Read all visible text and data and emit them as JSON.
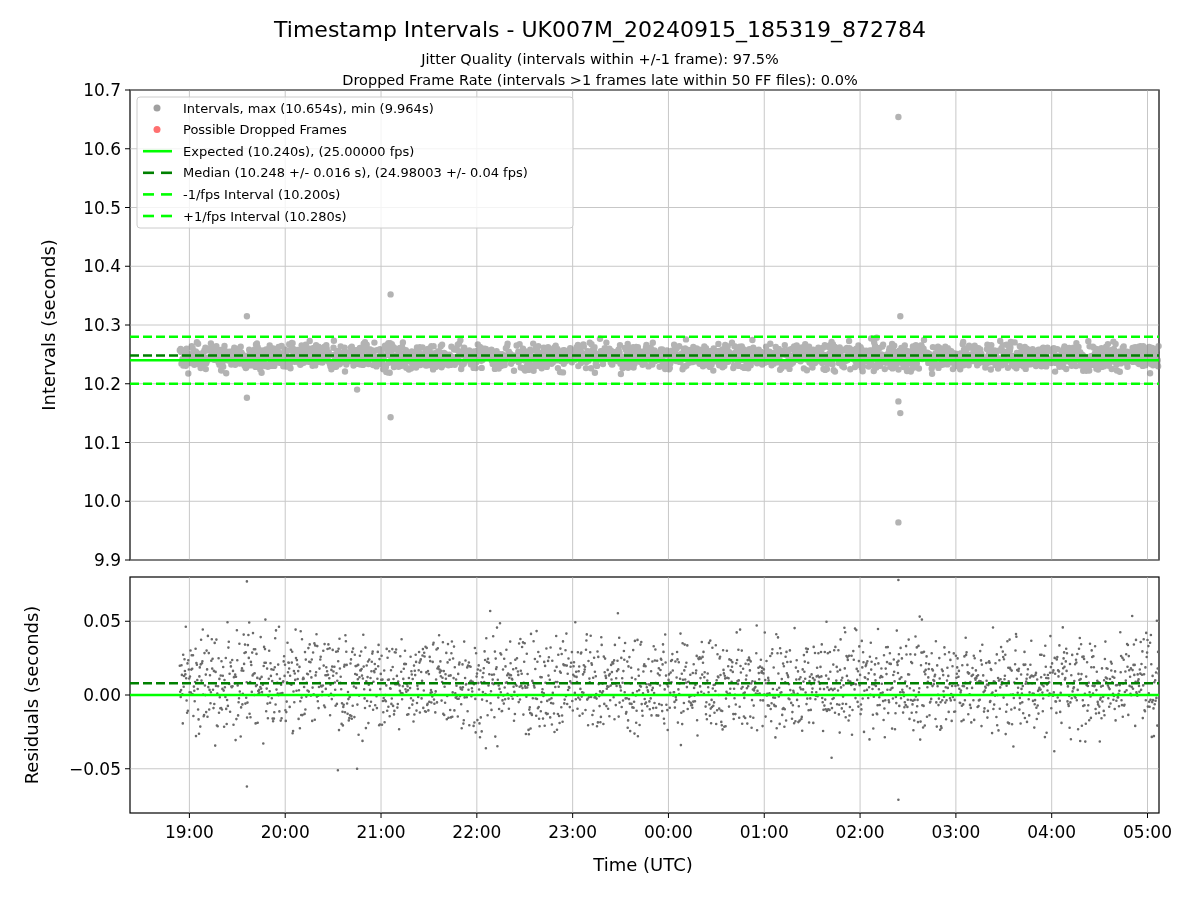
{
  "figure": {
    "title": "Timestamp Intervals - UK007M_20240915_185319_872784",
    "subtitles": [
      "Jitter Quality (intervals within +/-1 frame): 97.5%",
      "Dropped Frame Rate (intervals >1 frames late within 50 FF files): 0.0%"
    ]
  },
  "top_plot": {
    "legend": [
      {
        "label": "Intervals, max (10.654s), min (9.964s)",
        "color": "#a0a0a0",
        "kind": "marker"
      },
      {
        "label": "Possible Dropped Frames",
        "color": "#ff7070",
        "kind": "marker"
      },
      {
        "label": "Expected (10.240s), (25.00000 fps)",
        "color": "#00ff00",
        "kind": "solid"
      },
      {
        "label": "Median (10.248 +/- 0.016 s), (24.98003 +/- 0.04 fps)",
        "color": "#008000",
        "kind": "dashed"
      },
      {
        "label": "-1/fps Interval (10.200s)",
        "color": "#00ff00",
        "kind": "dashed"
      },
      {
        "label": "+1/fps Interval (10.280s)",
        "color": "#00ff00",
        "kind": "dashed"
      }
    ],
    "chart_data": {
      "type": "line",
      "ylabel": "Intervals (seconds)",
      "grid": true,
      "categories": [
        null,
        null,
        null,
        null,
        null,
        null,
        null,
        null,
        null,
        null,
        null
      ],
      "ylim": [
        9.9,
        10.7
      ],
      "yticks": [
        {
          "value": 9.9,
          "label": "9.9"
        },
        {
          "value": 10,
          "label": "10.0"
        },
        {
          "value": 10.1,
          "label": "10.1"
        },
        {
          "value": 10.2,
          "label": "10.2"
        },
        {
          "value": 10.3,
          "label": "10.3"
        },
        {
          "value": 10.4,
          "label": "10.4"
        },
        {
          "value": 10.5,
          "label": "10.5"
        },
        {
          "value": 10.6,
          "label": "10.6"
        },
        {
          "value": 10.7,
          "label": "10.7"
        }
      ],
      "ref_lines": [
        {
          "axis": "y",
          "value": 10.24,
          "color": "#00ff00"
        },
        {
          "axis": "y",
          "value": 10.248,
          "color": "#008000"
        },
        {
          "axis": "y",
          "value": 10.2,
          "color": "#00ff00"
        },
        {
          "axis": "y",
          "value": 10.28,
          "color": "#00ff00"
        }
      ]
    }
  },
  "bottom_plot": {
    "chart_data": {
      "type": "line",
      "xlabel": "Time (UTC)",
      "ylabel": "Residuals (seconds)",
      "grid": true,
      "categories": [
        "19:00",
        "20:00",
        "21:00",
        "22:00",
        "23:00",
        "00:00",
        "01:00",
        "02:00",
        "03:00",
        "04:00",
        "05:00"
      ],
      "ylim": [
        -0.08,
        0.08
      ],
      "yticks": [
        {
          "value": -0.05,
          "label": "−0.05"
        },
        {
          "value": 0,
          "label": "0.00"
        },
        {
          "value": 0.05,
          "label": "0.05"
        }
      ],
      "ref_lines": [
        {
          "axis": "y",
          "value": 0,
          "color": "#00ff00"
        },
        {
          "axis": "y",
          "value": 0.008,
          "color": "#008000"
        }
      ]
    }
  }
}
